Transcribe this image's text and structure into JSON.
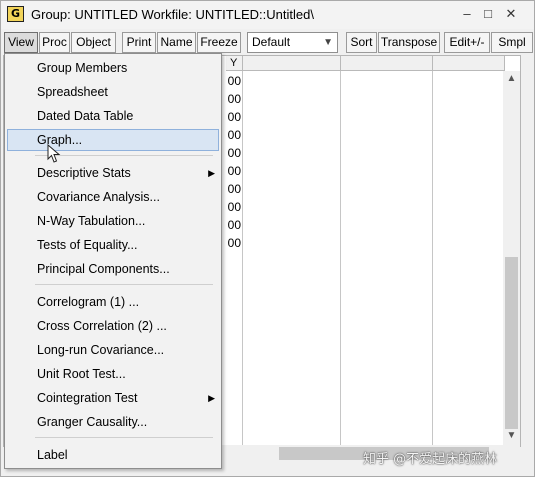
{
  "window": {
    "app_icon_letter": "G",
    "title": "Group: UNTITLED   Workfile: UNTITLED::Untitled\\",
    "minimize_glyph": "‒",
    "maximize_glyph": "□",
    "close_glyph": "✕"
  },
  "toolbar": {
    "view": "View",
    "proc": "Proc",
    "object": "Object",
    "print": "Print",
    "name": "Name",
    "freeze": "Freeze",
    "view_select": "Default",
    "sort": "Sort",
    "transpose": "Transpose",
    "edit": "Edit+/-",
    "smpl": "Smpl"
  },
  "sheet": {
    "column_header": "Y",
    "visible_cell_fragments": [
      "00",
      "00",
      "00",
      "00",
      "00",
      "00",
      "00",
      "00",
      "00",
      "00"
    ]
  },
  "menu": {
    "items": [
      {
        "label": "Group Members",
        "submenu": false
      },
      {
        "label": "Spreadsheet",
        "submenu": false
      },
      {
        "label": "Dated Data Table",
        "submenu": false
      },
      {
        "label": "Graph...",
        "submenu": false,
        "highlighted": true
      },
      {
        "label": "Descriptive Stats",
        "submenu": true
      },
      {
        "label": "Covariance Analysis...",
        "submenu": false
      },
      {
        "label": "N-Way Tabulation...",
        "submenu": false
      },
      {
        "label": "Tests of Equality...",
        "submenu": false
      },
      {
        "label": "Principal Components...",
        "submenu": false
      },
      {
        "label": "Correlogram (1) ...",
        "submenu": false
      },
      {
        "label": "Cross Correlation (2) ...",
        "submenu": false
      },
      {
        "label": "Long-run Covariance...",
        "submenu": false
      },
      {
        "label": "Unit Root Test...",
        "submenu": false
      },
      {
        "label": "Cointegration Test",
        "submenu": true
      },
      {
        "label": "Granger Causality...",
        "submenu": false
      },
      {
        "label": "Label",
        "submenu": false
      }
    ]
  },
  "watermark": "知乎 @不爱起床的燕林",
  "colors": {
    "highlight_bg": "#d9e5f3",
    "highlight_border": "#8fb1dc",
    "app_icon": "#f2d45a"
  }
}
